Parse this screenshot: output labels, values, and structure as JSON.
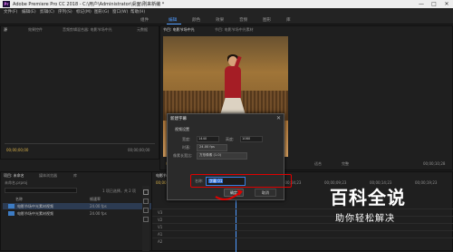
{
  "window": {
    "title": "Adobe Premiere Pro CC 2018 - C:\\用户\\Administrator\\桌面\\刚来新编 *",
    "app_icon": "Pr",
    "controls": [
      "—",
      "□",
      "✕"
    ]
  },
  "menu": [
    "文件(F)",
    "编辑(E)",
    "剪辑(C)",
    "序列(S)",
    "标记(M)",
    "图形(G)",
    "窗口(W)",
    "帮助(H)"
  ],
  "workspaces": {
    "items": [
      "组件",
      "编辑",
      "颜色",
      "效果",
      "音频",
      "图形",
      "库"
    ],
    "active_index": 1
  },
  "source_panel": {
    "tabs": [
      "源",
      "效果控件",
      "音频剪辑混合器: 电影节场中光",
      "元数据"
    ],
    "timecode_left": "00;00;00;00",
    "timecode_right": "00;00;00;00"
  },
  "program_panel": {
    "tabs": [
      "节目: 电影节场中光",
      "节目: 电影节场中光素材"
    ],
    "timecode_left": "00;00;10;00",
    "fit_label": "适合",
    "quality_label": "完整",
    "timecode_right": "00;00;10;28"
  },
  "project_panel": {
    "tabs": [
      "项目: 未命名",
      "媒体浏览器",
      "库"
    ],
    "path": "未命名.prproj",
    "item_count": "1 项已选择，共 2 项",
    "column_name": "名称",
    "column_rate": "帧速率",
    "files": [
      {
        "name": "电影节场中光素材视频",
        "rate": "24.00 fps"
      },
      {
        "name": "电影节场中光素材视频",
        "rate": "24.00 fps"
      }
    ]
  },
  "timeline_panel": {
    "tab": "电影节场中光",
    "timecode": "00;00;00;00",
    "ruler_marks": [
      "00;00",
      "00;00;04;23",
      "00;00;09;23",
      "00;00;14;23",
      "00;00;19;23"
    ],
    "tracks": [
      "V3",
      "V2",
      "V1",
      "A1",
      "A2"
    ]
  },
  "dialog": {
    "title": "新建字幕",
    "close": "✕",
    "section": "视频设置",
    "width_label": "宽度:",
    "width_value": "1440",
    "height_label": "高度:",
    "height_value": "1080",
    "timebase_label": "时基:",
    "timebase_value": "24.00 fps",
    "pixel_aspect_label": "像素长宽比:",
    "pixel_aspect_value": "方形像素 (1.0)",
    "name_label": "名称:",
    "name_value": "字幕 01",
    "ok_label": "确定",
    "cancel_label": "取消"
  },
  "watermark": {
    "big": "百科全说",
    "small": "助你轻松解决"
  },
  "colors": {
    "accent": "#4f9bff",
    "highlight": "#e00000",
    "panel_bg": "#1f1f1f"
  }
}
